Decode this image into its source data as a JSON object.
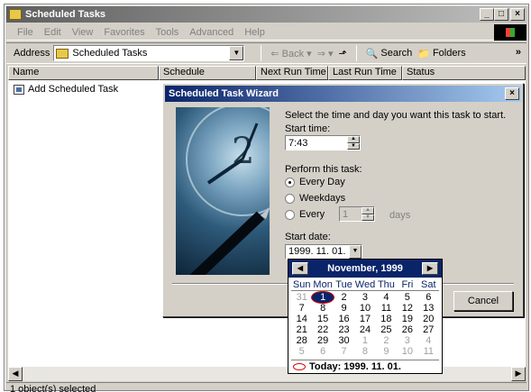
{
  "window": {
    "title": "Scheduled Tasks"
  },
  "menu": [
    "File",
    "Edit",
    "View",
    "Favorites",
    "Tools",
    "Advanced",
    "Help"
  ],
  "address": {
    "label": "Address",
    "value": "Scheduled Tasks"
  },
  "nav": {
    "back": "Back",
    "search": "Search",
    "folders": "Folders",
    "more": "»"
  },
  "columns": [
    "Name",
    "Schedule",
    "Next Run Time",
    "Last Run Time",
    "Status"
  ],
  "items": [
    {
      "name": "Add Scheduled Task"
    }
  ],
  "status": "1 object(s) selected",
  "wizard": {
    "title": "Scheduled Task Wizard",
    "prompt": "Select the time and day you want this task to start.",
    "start_time_label": "Start time:",
    "start_time": "7:43",
    "perform_label": "Perform this task:",
    "options": [
      {
        "label": "Every Day",
        "selected": true
      },
      {
        "label": "Weekdays",
        "selected": false
      },
      {
        "label": "Every",
        "selected": false
      }
    ],
    "every_value": "1",
    "days_label": "days",
    "start_date_label": "Start date:",
    "start_date": "1999. 11. 01.",
    "cancel": "Cancel"
  },
  "calendar": {
    "month": "November, 1999",
    "dow": [
      "Sun",
      "Mon",
      "Tue",
      "Wed",
      "Thu",
      "Fri",
      "Sat"
    ],
    "weeks": [
      [
        "31",
        "1",
        "2",
        "3",
        "4",
        "5",
        "6"
      ],
      [
        "7",
        "8",
        "9",
        "10",
        "11",
        "12",
        "13"
      ],
      [
        "14",
        "15",
        "16",
        "17",
        "18",
        "19",
        "20"
      ],
      [
        "21",
        "22",
        "23",
        "24",
        "25",
        "26",
        "27"
      ],
      [
        "28",
        "29",
        "30",
        "1",
        "2",
        "3",
        "4"
      ],
      [
        "5",
        "6",
        "7",
        "8",
        "9",
        "10",
        "11"
      ]
    ],
    "today": "Today: 1999. 11. 01."
  }
}
